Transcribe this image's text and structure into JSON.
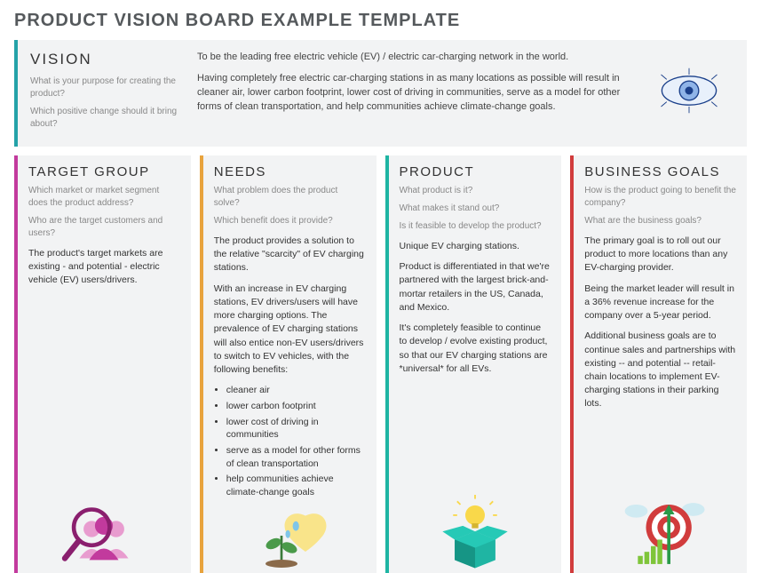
{
  "title": "PRODUCT VISION BOARD EXAMPLE TEMPLATE",
  "vision": {
    "heading": "VISION",
    "prompt1": "What is your purpose for creating the product?",
    "prompt2": "Which positive change should it bring about?",
    "para1": "To be the leading free electric vehicle (EV) / electric car-charging network in the world.",
    "para2": "Having completely free electric car-charging stations in as many locations as possible will result in cleaner air, lower carbon footprint, lower cost of driving in communities, serve as a model for other forms of clean transportation, and help communities achieve climate-change goals."
  },
  "target": {
    "heading": "TARGET GROUP",
    "prompt1": "Which market or market segment does the product address?",
    "prompt2": "Who are the target customers and users?",
    "para1": "The product's target markets are existing - and potential - electric vehicle (EV) users/drivers."
  },
  "needs": {
    "heading": "NEEDS",
    "prompt1": "What problem does the product solve?",
    "prompt2": "Which benefit does it provide?",
    "para1": "The product provides a solution to the relative \"scarcity\" of EV charging stations.",
    "para2": "With an increase in EV charging stations, EV drivers/users will have more charging options. The prevalence of EV charging stations will also entice non-EV users/drivers to switch to EV vehicles, with the following benefits:",
    "bullets": [
      "cleaner air",
      "lower carbon footprint",
      "lower cost of driving in communities",
      "serve as a model for other forms of clean transportation",
      "help communities achieve climate-change goals"
    ]
  },
  "product": {
    "heading": "PRODUCT",
    "prompt1": "What product is it?",
    "prompt2": "What makes it stand out?",
    "prompt3": "Is it feasible to develop the product?",
    "para1": "Unique EV charging stations.",
    "para2": "Product is differentiated in that we're partnered with the largest brick-and-mortar retailers in the US, Canada, and Mexico.",
    "para3": "It's completely feasible to continue to develop / evolve existing product, so that our EV charging stations are *universal* for all EVs."
  },
  "goals": {
    "heading": "BUSINESS GOALS",
    "prompt1": "How is the product going to benefit the company?",
    "prompt2": "What are the business goals?",
    "para1": "The primary goal is to roll out our product to more locations than any EV-charging provider.",
    "para2": "Being the market leader will result in a 36% revenue increase for the company over a 5-year period.",
    "para3": "Additional business goals are to continue sales and partnerships with existing -- and potential -- retail-chain locations to implement EV-charging stations in their parking lots."
  }
}
